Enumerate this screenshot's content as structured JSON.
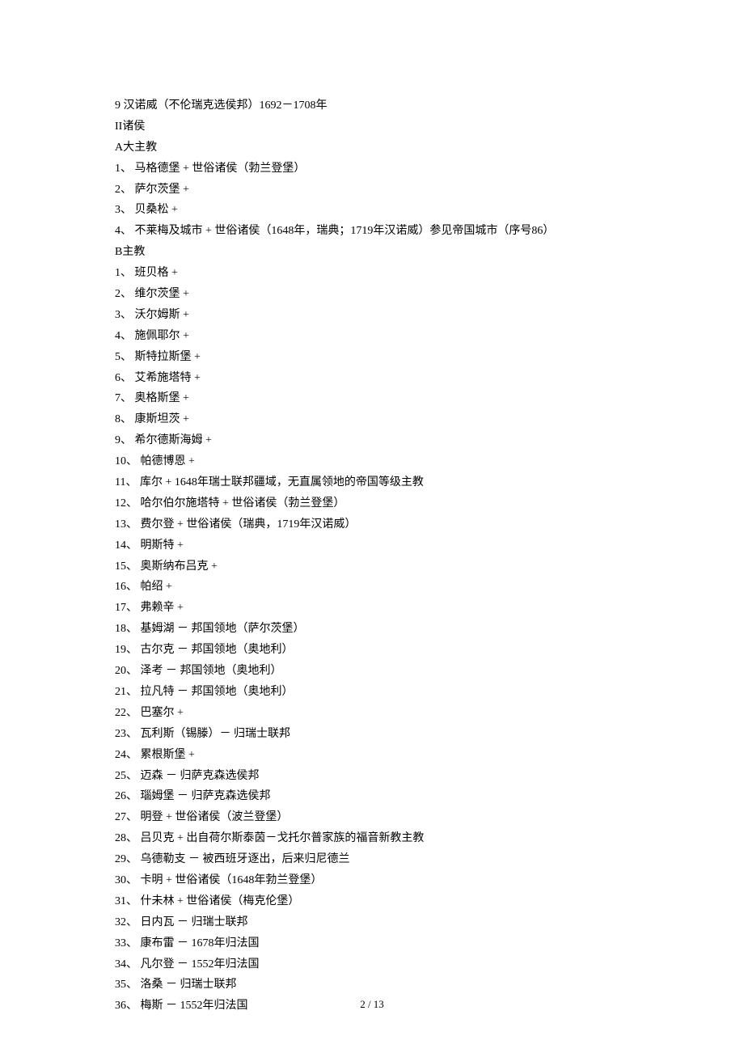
{
  "intro_lines": [
    "9 汉诺威（不伦瑞克选侯邦）1692－1708年",
    "II诸侯",
    "A大主教",
    "1、 马格德堡 + 世俗诸侯（勃兰登堡）",
    "2、 萨尔茨堡 +",
    "3、 贝桑松 +",
    "4、 不莱梅及城市 + 世俗诸侯（1648年，瑞典；1719年汉诺威）参见帝国城市（序号86）",
    "B主教"
  ],
  "bishop_list": [
    "1、 班贝格 +",
    "2、 维尔茨堡 +",
    "3、 沃尔姆斯 +",
    "4、 施佩耶尔 +",
    "5、 斯特拉斯堡 +",
    "6、 艾希施塔特 +",
    "7、 奥格斯堡 +",
    "8、 康斯坦茨 +",
    "9、 希尔德斯海姆 +",
    "10、 帕德博恩 +",
    "11、 库尔 + 1648年瑞士联邦疆域，无直属领地的帝国等级主教",
    "12、 哈尔伯尔施塔特 + 世俗诸侯（勃兰登堡）",
    "13、 费尔登 + 世俗诸侯（瑞典，1719年汉诺威）",
    "14、 明斯特 +",
    "15、 奥斯纳布吕克 +",
    "16、 帕绍 +",
    "17、 弗赖辛 +",
    "18、 基姆湖 － 邦国领地（萨尔茨堡）",
    "19、 古尔克 － 邦国领地（奥地利）",
    "20、 泽考 － 邦国领地（奥地利）",
    "21、 拉凡特 － 邦国领地（奥地利）",
    "22、 巴塞尔 +",
    "23、 瓦利斯（锡滕）－ 归瑞士联邦",
    "24、 累根斯堡 +",
    "25、 迈森 － 归萨克森选侯邦",
    "26、 瑙姆堡 － 归萨克森选侯邦",
    "27、 明登 + 世俗诸侯（波兰登堡）",
    "28、 吕贝克 + 出自荷尔斯泰茵－戈托尔普家族的福音新教主教",
    "29、 乌德勒支 － 被西班牙逐出，后来归尼德兰",
    "30、 卡明 + 世俗诸侯（1648年勃兰登堡）",
    "31、 什未林 + 世俗诸侯（梅克伦堡）",
    "32、 日内瓦 － 归瑞士联邦",
    "33、 康布雷 － 1678年归法国",
    "34、 凡尔登 － 1552年归法国",
    "35、 洛桑 － 归瑞士联邦",
    "36、 梅斯 － 1552年归法国"
  ],
  "footer": "2 / 13"
}
